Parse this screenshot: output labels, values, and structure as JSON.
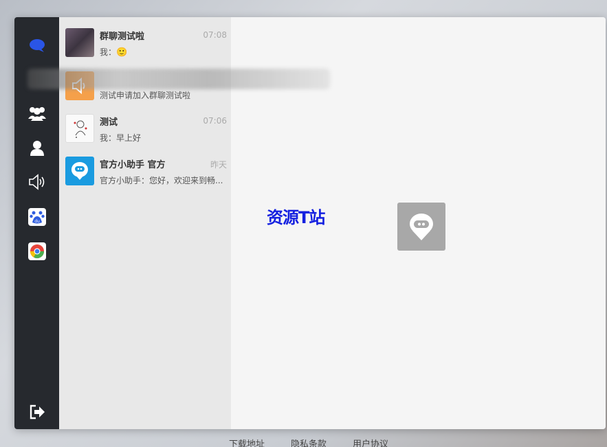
{
  "conversations": [
    {
      "name": "群聊测试啦",
      "time": "07:08",
      "message": "我：",
      "emoji": "🙂"
    },
    {
      "name": "",
      "time": "",
      "message": "测试申请加入群聊测试啦"
    },
    {
      "name": "测试",
      "time": "07:06",
      "message": "我：早上好"
    },
    {
      "name": "官方小助手 官方",
      "time": "昨天",
      "message": "官方小助手：您好，欢迎来到畅..."
    }
  ],
  "watermark": "资源T站",
  "footer": {
    "download": "下载地址",
    "privacy": "隐私条款",
    "agreement": "用户协议"
  },
  "colors": {
    "sidebar": "#26292e",
    "list": "#e8e8e8",
    "main": "#f5f5f5",
    "brand_blue": "#2255ee",
    "assistant_blue": "#1a9be0",
    "notice_orange": "#f5a04a"
  },
  "icons": [
    "chat-bubble-icon",
    "group-icon",
    "contact-icon",
    "speaker-icon",
    "baidu-paw-icon",
    "chrome-icon",
    "logout-icon"
  ]
}
